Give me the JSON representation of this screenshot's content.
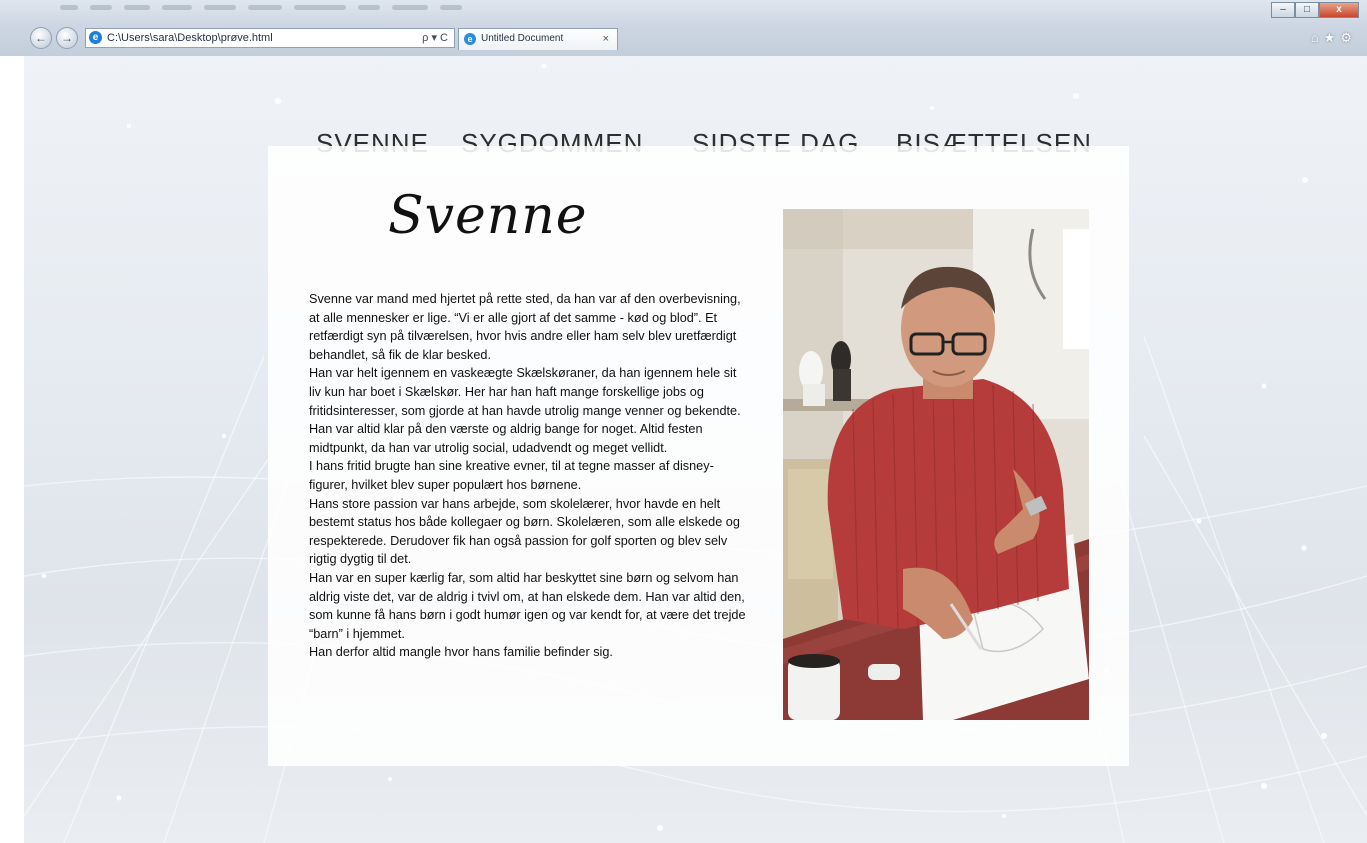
{
  "browser": {
    "address_url": "C:\\Users\\sara\\Desktop\\prøve.html",
    "address_actions": "ρ ▾ C",
    "tab_title": "Untitled Document",
    "tab_close": "×",
    "back_label": "←",
    "forward_label": "→",
    "minimize": "–",
    "maximize": "□",
    "close": "x",
    "toolbar_icons": "⌂★⚙"
  },
  "nav": {
    "items": [
      "SVENNE",
      "SYGDOMMEN",
      "SIDSTE DAG",
      "BISÆTTELSEN"
    ]
  },
  "content": {
    "heading": "Svenne",
    "paragraphs": [
      "Svenne var mand med hjertet på rette sted, da han var af den overbevisning, at alle mennesker er lige. “Vi er alle gjort af det samme - kød og blod”. Et retfærdigt syn på tilværelsen, hvor hvis andre eller ham selv blev uretfærdigt behandlet, så fik de klar besked.",
      "Han var helt igennem en vaskeægte Skælskøraner, da han igennem hele sit liv kun har boet i Skælskør. Her har han haft mange forskellige jobs og fritidsinteresser, som gjorde at han havde utrolig mange venner og bekendte.",
      "Han var altid klar på den værste og aldrig bange for noget. Altid festen midtpunkt, da han var utrolig social, udadvendt og meget vellidt.",
      "I hans fritid brugte han sine kreative evner, til at tegne masser af disney-figurer, hvilket blev super populært hos børnene.",
      "Hans store passion var hans arbejde, som skolelærer, hvor havde en helt bestemt status hos både kollegaer og børn. Skolelæren, som alle elskede og respekterede. Derudover fik han også passion for golf sporten og blev selv rigtig dygtig til det.",
      "Han var en super kærlig far, som altid har beskyttet sine børn og selvom han aldrig viste det, var de aldrig i tvivl om, at han elskede dem. Han var altid den, som kunne få hans børn i godt humør igen og var kendt for, at være det trejde “barn” i hjemmet.",
      "Han derfor altid mangle hvor hans familie befinder sig."
    ]
  },
  "colors": {
    "nav_text": "#2e2e2e",
    "panel_bg": "#ffffff",
    "shirt": "#b53c3a"
  }
}
